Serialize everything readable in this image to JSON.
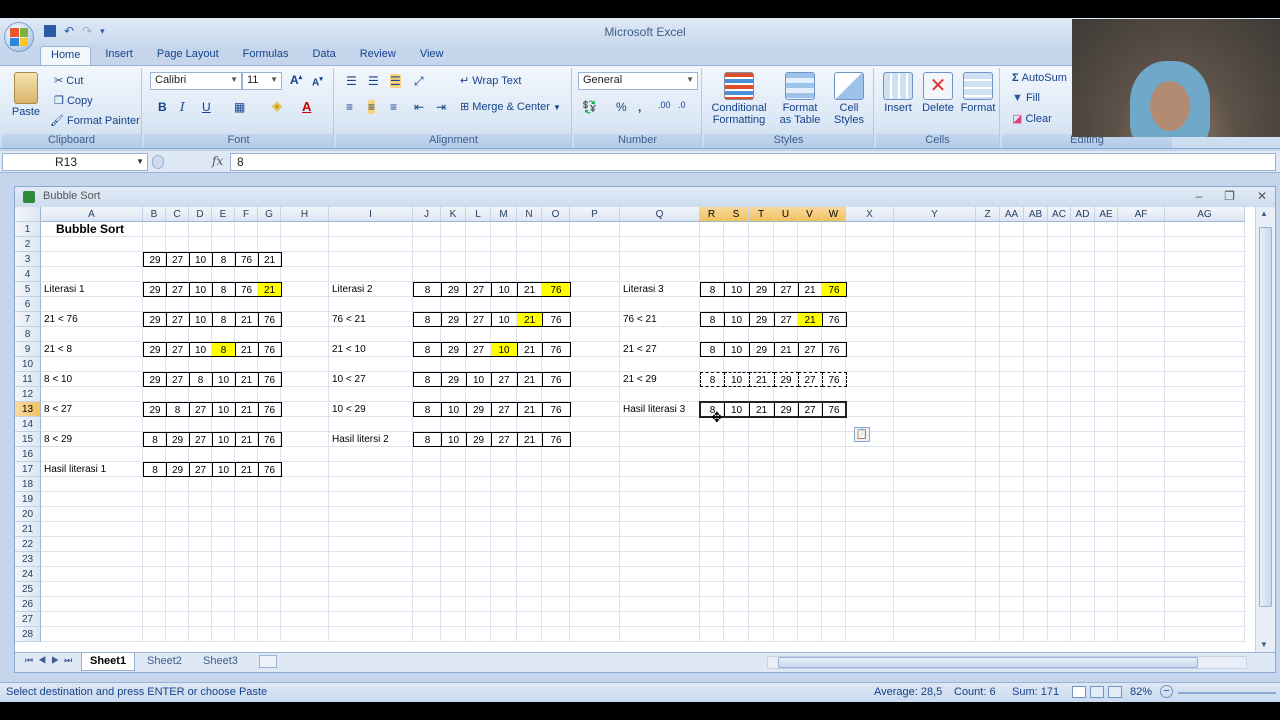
{
  "window": {
    "title": "Microsoft Excel"
  },
  "ribbon": {
    "tabs": [
      "Home",
      "Insert",
      "Page Layout",
      "Formulas",
      "Data",
      "Review",
      "View"
    ],
    "clipboard": {
      "label": "Clipboard",
      "paste": "Paste",
      "cut": "Cut",
      "copy": "Copy",
      "format_painter": "Format Painter"
    },
    "font": {
      "label": "Font",
      "name": "Calibri",
      "size": "11"
    },
    "alignment": {
      "label": "Alignment",
      "wrap_text": "Wrap Text",
      "merge_center": "Merge & Center"
    },
    "number": {
      "label": "Number",
      "format": "General"
    },
    "styles": {
      "label": "Styles",
      "conditional": "Conditional",
      "conditional2": "Formatting",
      "format_table": "Format",
      "format_table2": "as Table",
      "cell_styles": "Cell",
      "cell_styles2": "Styles"
    },
    "cells": {
      "label": "Cells",
      "insert": "Insert",
      "delete": "Delete",
      "format": "Format"
    },
    "editing": {
      "label": "Editing",
      "autosum": "AutoSum",
      "fill": "Fill",
      "clear": "Clear"
    }
  },
  "formula_bar": {
    "name_box": "R13",
    "fx": "fx",
    "value": "8"
  },
  "workbook": {
    "title": "Bubble Sort",
    "sheets": [
      "Sheet1",
      "Sheet2",
      "Sheet3"
    ],
    "active_sheet": "Sheet1"
  },
  "status": {
    "message": "Select destination and press ENTER or choose Paste",
    "average": "Average: 28,5",
    "count": "Count: 6",
    "sum": "Sum: 171",
    "zoom": "82%"
  },
  "grid": {
    "columns": [
      "A",
      "B",
      "C",
      "D",
      "E",
      "F",
      "G",
      "H",
      "I",
      "J",
      "K",
      "L",
      "M",
      "N",
      "O",
      "P",
      "Q",
      "R",
      "S",
      "T",
      "U",
      "V",
      "W",
      "X",
      "Y",
      "Z",
      "AA",
      "AB",
      "AC",
      "AD",
      "AE",
      "AF",
      "AG"
    ],
    "rows": 28,
    "selected_column": [
      "R",
      "S",
      "T",
      "U",
      "V",
      "W"
    ],
    "selected_row": 13,
    "texts": [
      {
        "cell": "A1",
        "text": "Bubble Sort",
        "style": "title"
      },
      {
        "cell": "A5",
        "text": "Literasi 1"
      },
      {
        "cell": "A7",
        "text": "21 < 76"
      },
      {
        "cell": "A9",
        "text": "21 < 8"
      },
      {
        "cell": "A11",
        "text": "8 < 10"
      },
      {
        "cell": "A13",
        "text": "8 < 27"
      },
      {
        "cell": "A15",
        "text": "8 < 29"
      },
      {
        "cell": "A17",
        "text": "Hasil literasi 1"
      },
      {
        "cell": "I5",
        "text": "Literasi 2"
      },
      {
        "cell": "I7",
        "text": "76 < 21"
      },
      {
        "cell": "I9",
        "text": "21 < 10"
      },
      {
        "cell": "I11",
        "text": "10 < 27"
      },
      {
        "cell": "I13",
        "text": "10 < 29"
      },
      {
        "cell": "I15",
        "text": "Hasil litersi 2"
      },
      {
        "cell": "Q5",
        "text": "Literasi 3"
      },
      {
        "cell": "Q7",
        "text": "76 < 21"
      },
      {
        "cell": "Q9",
        "text": "21 < 27"
      },
      {
        "cell": "Q11",
        "text": "21 < 29"
      },
      {
        "cell": "Q13",
        "text": "Hasil literasi 3"
      }
    ],
    "number_rows": [
      {
        "row": 3,
        "start": "B",
        "values": [
          "29",
          "27",
          "10",
          "8",
          "76",
          "21"
        ],
        "hl": []
      },
      {
        "row": 5,
        "start": "B",
        "values": [
          "29",
          "27",
          "10",
          "8",
          "76",
          "21"
        ],
        "hl": [
          5
        ]
      },
      {
        "row": 7,
        "start": "B",
        "values": [
          "29",
          "27",
          "10",
          "8",
          "21",
          "76"
        ],
        "hl": []
      },
      {
        "row": 9,
        "start": "B",
        "values": [
          "29",
          "27",
          "10",
          "8",
          "21",
          "76"
        ],
        "hl": [
          3
        ]
      },
      {
        "row": 11,
        "start": "B",
        "values": [
          "29",
          "27",
          "8",
          "10",
          "21",
          "76"
        ],
        "hl": []
      },
      {
        "row": 13,
        "start": "B",
        "values": [
          "29",
          "8",
          "27",
          "10",
          "21",
          "76"
        ],
        "hl": []
      },
      {
        "row": 15,
        "start": "B",
        "values": [
          "8",
          "29",
          "27",
          "10",
          "21",
          "76"
        ],
        "hl": []
      },
      {
        "row": 17,
        "start": "B",
        "values": [
          "8",
          "29",
          "27",
          "10",
          "21",
          "76"
        ],
        "hl": []
      },
      {
        "row": 5,
        "start": "J",
        "values": [
          "8",
          "29",
          "27",
          "10",
          "21",
          "76"
        ],
        "hl": [
          5
        ]
      },
      {
        "row": 7,
        "start": "J",
        "values": [
          "8",
          "29",
          "27",
          "10",
          "21",
          "76"
        ],
        "hl": [
          4
        ]
      },
      {
        "row": 9,
        "start": "J",
        "values": [
          "8",
          "29",
          "27",
          "10",
          "21",
          "76"
        ],
        "hl": [
          3
        ]
      },
      {
        "row": 11,
        "start": "J",
        "values": [
          "8",
          "29",
          "10",
          "27",
          "21",
          "76"
        ],
        "hl": []
      },
      {
        "row": 13,
        "start": "J",
        "values": [
          "8",
          "10",
          "29",
          "27",
          "21",
          "76"
        ],
        "hl": []
      },
      {
        "row": 15,
        "start": "J",
        "values": [
          "8",
          "10",
          "29",
          "27",
          "21",
          "76"
        ],
        "hl": []
      },
      {
        "row": 5,
        "start": "R",
        "values": [
          "8",
          "10",
          "29",
          "27",
          "21",
          "76"
        ],
        "hl": [
          5
        ]
      },
      {
        "row": 7,
        "start": "R",
        "values": [
          "8",
          "10",
          "29",
          "27",
          "21",
          "76"
        ],
        "hl": [
          4
        ]
      },
      {
        "row": 9,
        "start": "R",
        "values": [
          "8",
          "10",
          "29",
          "21",
          "27",
          "76"
        ],
        "hl": []
      },
      {
        "row": 11,
        "start": "R",
        "values": [
          "8",
          "10",
          "21",
          "29",
          "27",
          "76"
        ],
        "hl": [],
        "dashed": true
      },
      {
        "row": 13,
        "start": "R",
        "values": [
          "8",
          "10",
          "21",
          "29",
          "27",
          "76"
        ],
        "hl": []
      }
    ]
  }
}
